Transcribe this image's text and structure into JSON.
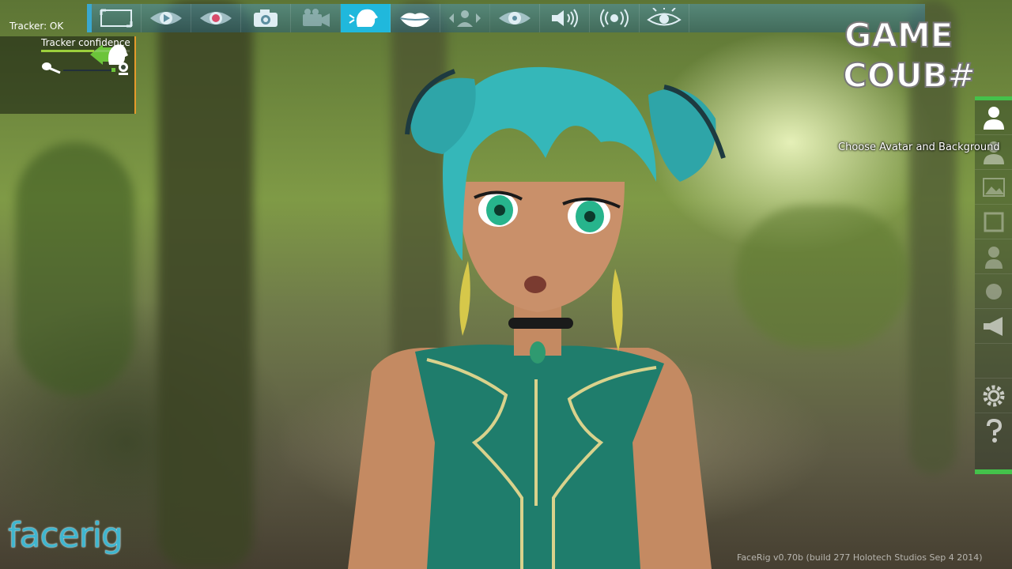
{
  "toolbar": {
    "tools": [
      {
        "name": "fullscreen-icon",
        "active": false
      },
      {
        "name": "play-icon",
        "active": false
      },
      {
        "name": "record-icon",
        "active": false
      },
      {
        "name": "camera-icon",
        "active": false
      },
      {
        "name": "video-camera-icon",
        "active": false
      },
      {
        "name": "head-icon",
        "active": true
      },
      {
        "name": "lips-icon",
        "active": false
      },
      {
        "name": "avatar-switch-icon",
        "active": false
      },
      {
        "name": "eye-track-icon",
        "active": false
      },
      {
        "name": "speaker-icon",
        "active": false
      },
      {
        "name": "broadcast-icon",
        "active": false
      },
      {
        "name": "eye-view-icon",
        "active": false
      }
    ],
    "accent_color": "#20b8dc"
  },
  "tracker": {
    "status_label": "Tracker: OK",
    "confidence_label": "Tracker confidence",
    "confidence_fraction": 0.6,
    "status_icon": "green-head-icon",
    "mic_icon": "microphone-icon",
    "webcam_icon": "webcam-icon"
  },
  "watermark": {
    "line1": "GAME",
    "line2": "COUB#"
  },
  "sidebar": {
    "tooltip": "Choose Avatar and Background",
    "items": [
      {
        "name": "avatar-icon"
      },
      {
        "name": "avatar-alt-icon"
      },
      {
        "name": "background-icon"
      },
      {
        "name": "frame-icon"
      },
      {
        "name": "person-icon"
      },
      {
        "name": "props-icon"
      },
      {
        "name": "megaphone-icon"
      },
      {
        "name": "settings-gear-icon"
      },
      {
        "name": "help-icon"
      }
    ],
    "accent_color": "#44c24b"
  },
  "logo": {
    "text": "facerig"
  },
  "version": {
    "text": "FaceRig v0.70b (build 277 Holotech Studios   Sep  4 2014)"
  }
}
